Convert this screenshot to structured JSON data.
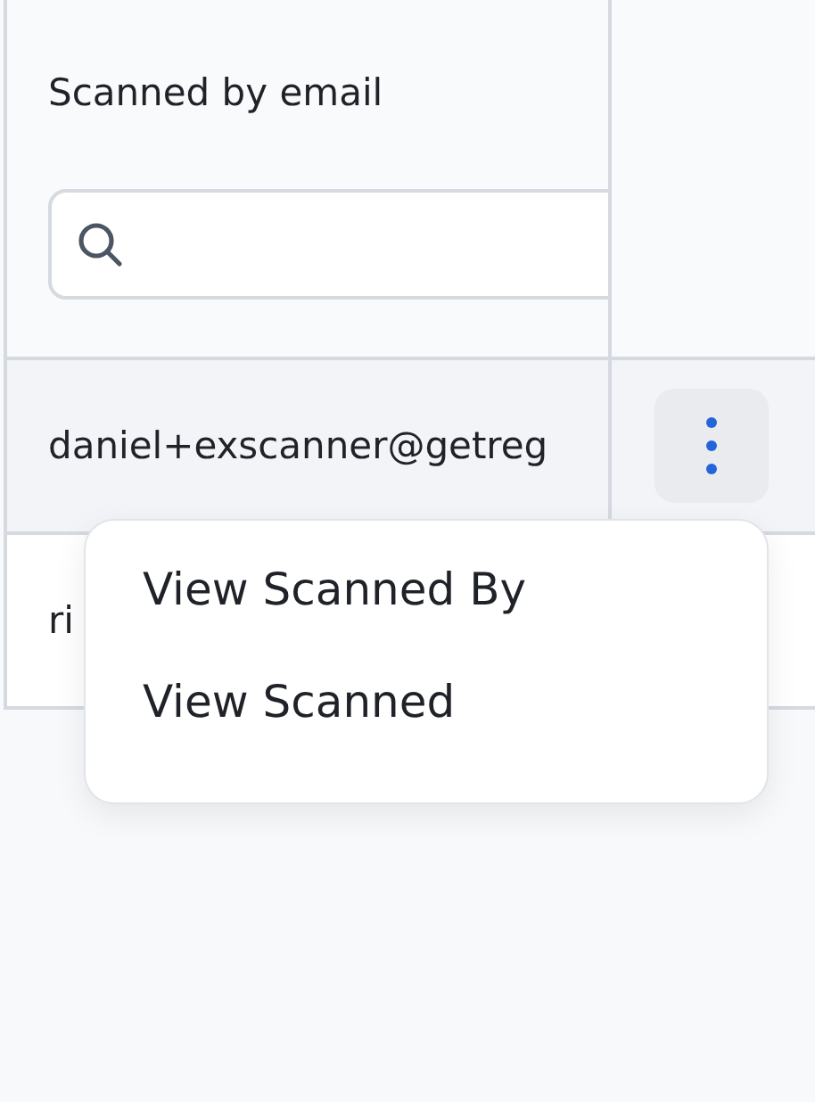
{
  "table": {
    "columns": [
      {
        "heading": "Scanned by email"
      }
    ],
    "rows": [
      {
        "email": "daniel+exscanner@getreg",
        "highlighted": true
      },
      {
        "email": "ri",
        "highlighted": false
      }
    ]
  },
  "context_menu": {
    "items": [
      {
        "label": "View Scanned By"
      },
      {
        "label": "View Scanned"
      }
    ]
  }
}
